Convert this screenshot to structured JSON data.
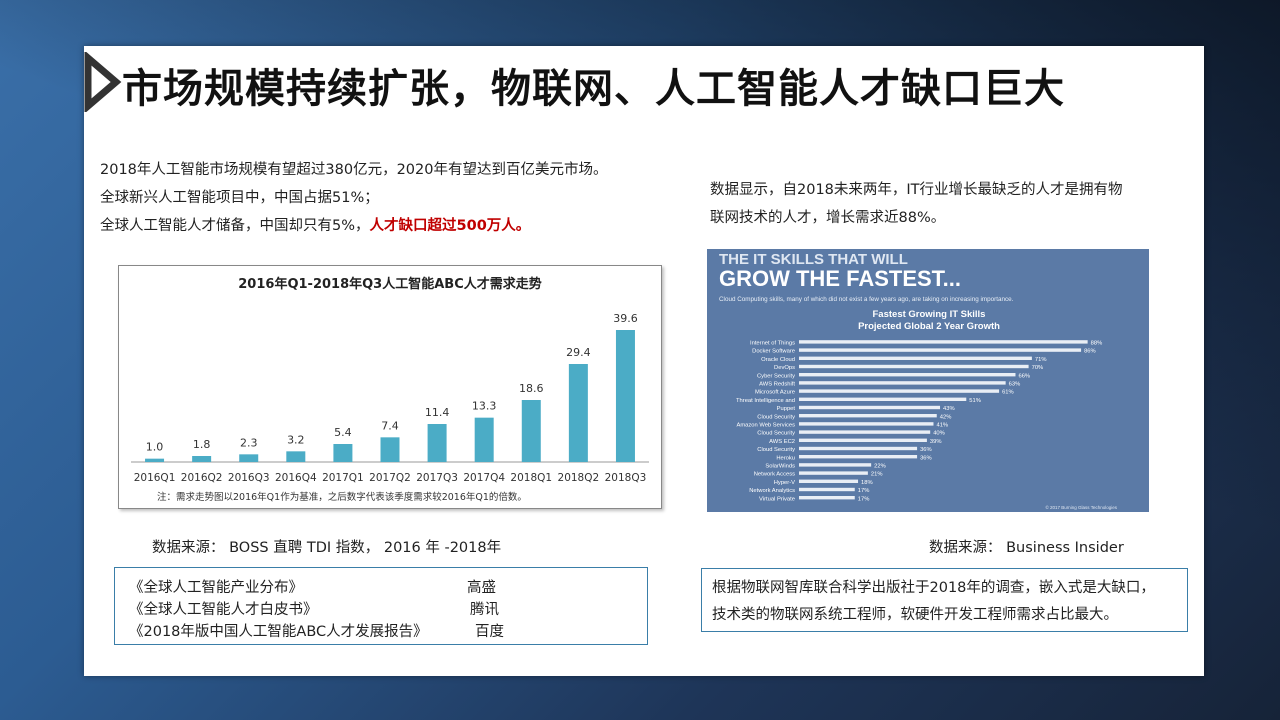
{
  "title": "市场规模持续扩张，物联网、人工智能人才缺口巨大",
  "intro": {
    "line1": "2018年人工智能市场规模有望超过380亿元，2020年有望达到百亿美元市场。",
    "line2": "全球新兴人工智能项目中，中国占据51%；",
    "line3_prefix": "全球人工智能人才储备，中国却只有5%，",
    "line3_highlight": "人才缺口超过500万人。"
  },
  "chart_data": [
    {
      "type": "bar",
      "title": "2016年Q1-2018年Q3人工智能ABC人才需求走势",
      "categories": [
        "2016Q1",
        "2016Q2",
        "2016Q3",
        "2016Q4",
        "2017Q1",
        "2017Q2",
        "2017Q3",
        "2017Q4",
        "2018Q1",
        "2018Q2",
        "2018Q3"
      ],
      "values": [
        1.0,
        1.8,
        2.3,
        3.2,
        5.4,
        7.4,
        11.4,
        13.3,
        18.6,
        29.4,
        39.6
      ],
      "value_labels": [
        "1.0",
        "1.8",
        "2.3",
        "3.2",
        "5.4",
        "7.4",
        "11.4",
        "13.3",
        "18.6",
        "29.4",
        "39.6"
      ],
      "note": "注：需求走势图以2016年Q1作为基准，之后数字代表该季度需求较2016年Q1的倍数。",
      "ylim": [
        0,
        45
      ],
      "grid": false,
      "color": "#4bacc6"
    },
    {
      "type": "bar",
      "orientation": "horizontal",
      "header1": "THE IT SKILLS THAT WILL",
      "header2": "GROW THE FASTEST...",
      "subtitle": "Cloud Computing skills, many of which did not exist a few years ago, are taking on increasing importance.",
      "title_line1": "Fastest Growing IT Skills",
      "title_line2": "Projected Global 2 Year Growth",
      "categories": [
        "Internet of Things",
        "Docker Software",
        "Oracle Cloud",
        "DevOps",
        "Cyber Security",
        "AWS Redshift",
        "Microsoft Azure",
        "Threat Intelligence and",
        "Puppet",
        "Cloud Security",
        "Amazon Web Services",
        "Cloud Security",
        "AWS EC2",
        "Cloud Security",
        "Heroku",
        "SolarWinds",
        "Network Access",
        "Hyper-V",
        "Network Analytics",
        "Virtual Private"
      ],
      "values": [
        88,
        86,
        71,
        70,
        66,
        63,
        61,
        51,
        43,
        42,
        41,
        40,
        39,
        36,
        36,
        22,
        21,
        18,
        17,
        17
      ],
      "value_labels": [
        "88%",
        "86%",
        "71%",
        "70%",
        "66%",
        "63%",
        "61%",
        "51%",
        "43%",
        "42%",
        "41%",
        "40%",
        "39%",
        "36%",
        "36%",
        "22%",
        "21%",
        "18%",
        "17%",
        "17%"
      ],
      "xlim": [
        0,
        100
      ],
      "footer": "© 2017 Burning Glass Technologies"
    }
  ],
  "right_text": {
    "line1": "数据显示，自2018未来两年，IT行业增长最缺乏的人才是拥有物",
    "line2": "联网技术的人才，增长需求近88%。"
  },
  "source_left": "数据来源：  BOSS 直聘 TDI 指数， 2016 年 -2018年",
  "source_right": "数据来源：  Business Insider",
  "references": [
    {
      "title": "《全球人工智能产业分布》",
      "org": "高盛"
    },
    {
      "title": "《全球人工智能人才白皮书》",
      "org": "腾讯"
    },
    {
      "title": "《2018年版中国人工智能ABC人才发展报告》",
      "org": "百度"
    }
  ],
  "note_box": {
    "line1": "根据物联网智库联合科学出版社于2018年的调查，嵌入式是大缺口，",
    "line2": "技术类的物联网系统工程师，软硬件开发工程师需求占比最大。"
  }
}
